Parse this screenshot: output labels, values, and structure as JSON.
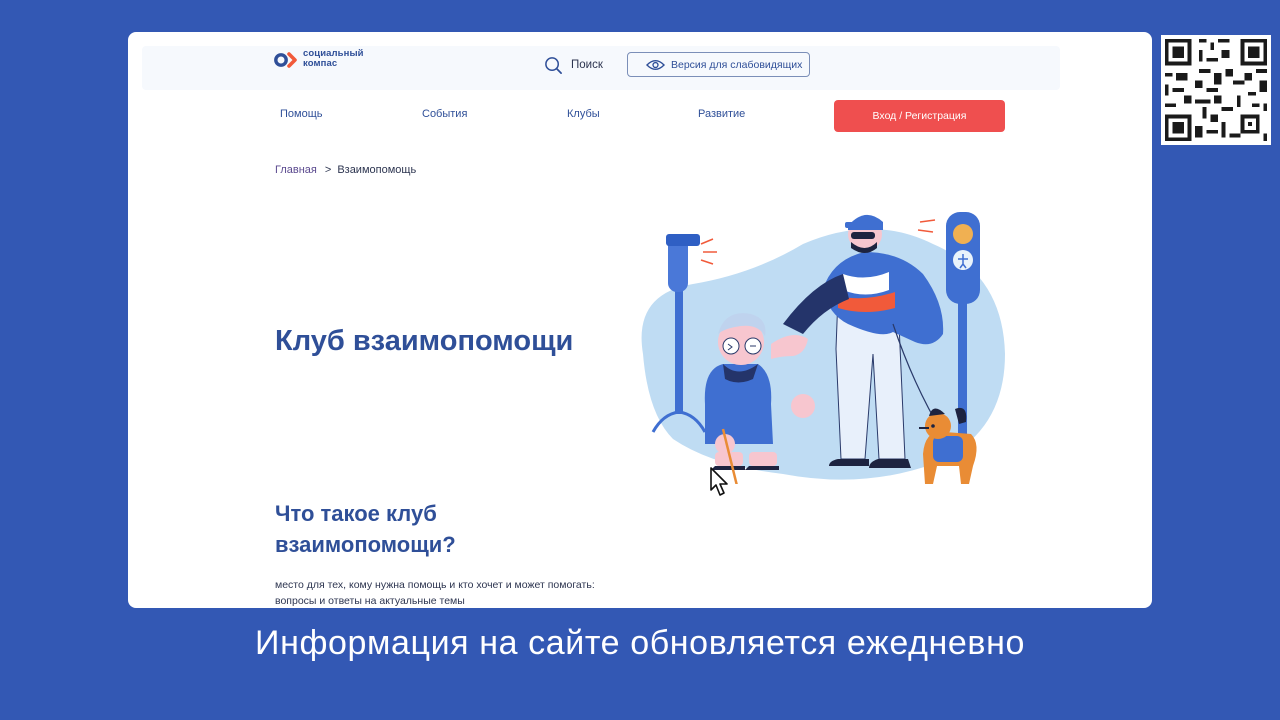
{
  "header": {
    "logo_text_line1": "социальный",
    "logo_text_line2": "компас",
    "search_label": "Поиск",
    "low_vision_label": "Версия для слабовидящих"
  },
  "nav": {
    "items": [
      {
        "label": "Помощь"
      },
      {
        "label": "События"
      },
      {
        "label": "Клубы"
      },
      {
        "label": "Развитие"
      }
    ],
    "login_label": "Вход / Регистрация"
  },
  "breadcrumb": {
    "home": "Главная",
    "separator": ">",
    "current": "Взаимопомощь"
  },
  "hero": {
    "title": "Клуб взаимопомощи"
  },
  "section": {
    "title": "Что такое клуб взаимопомощи?",
    "text_line1": "место для тех, кому нужна помощь и кто хочет и может помогать:",
    "text_line2": "вопросы и ответы на актуальные темы"
  },
  "caption": "Информация на сайте обновляется ежедневно",
  "colors": {
    "background": "#3358b4",
    "brand_blue": "#2f4f98",
    "accent_red": "#ef4f4f",
    "logo_orange": "#f15a3a"
  },
  "icons": [
    "logo-mark",
    "search-icon",
    "eye-icon",
    "cursor-icon",
    "qr-code"
  ]
}
